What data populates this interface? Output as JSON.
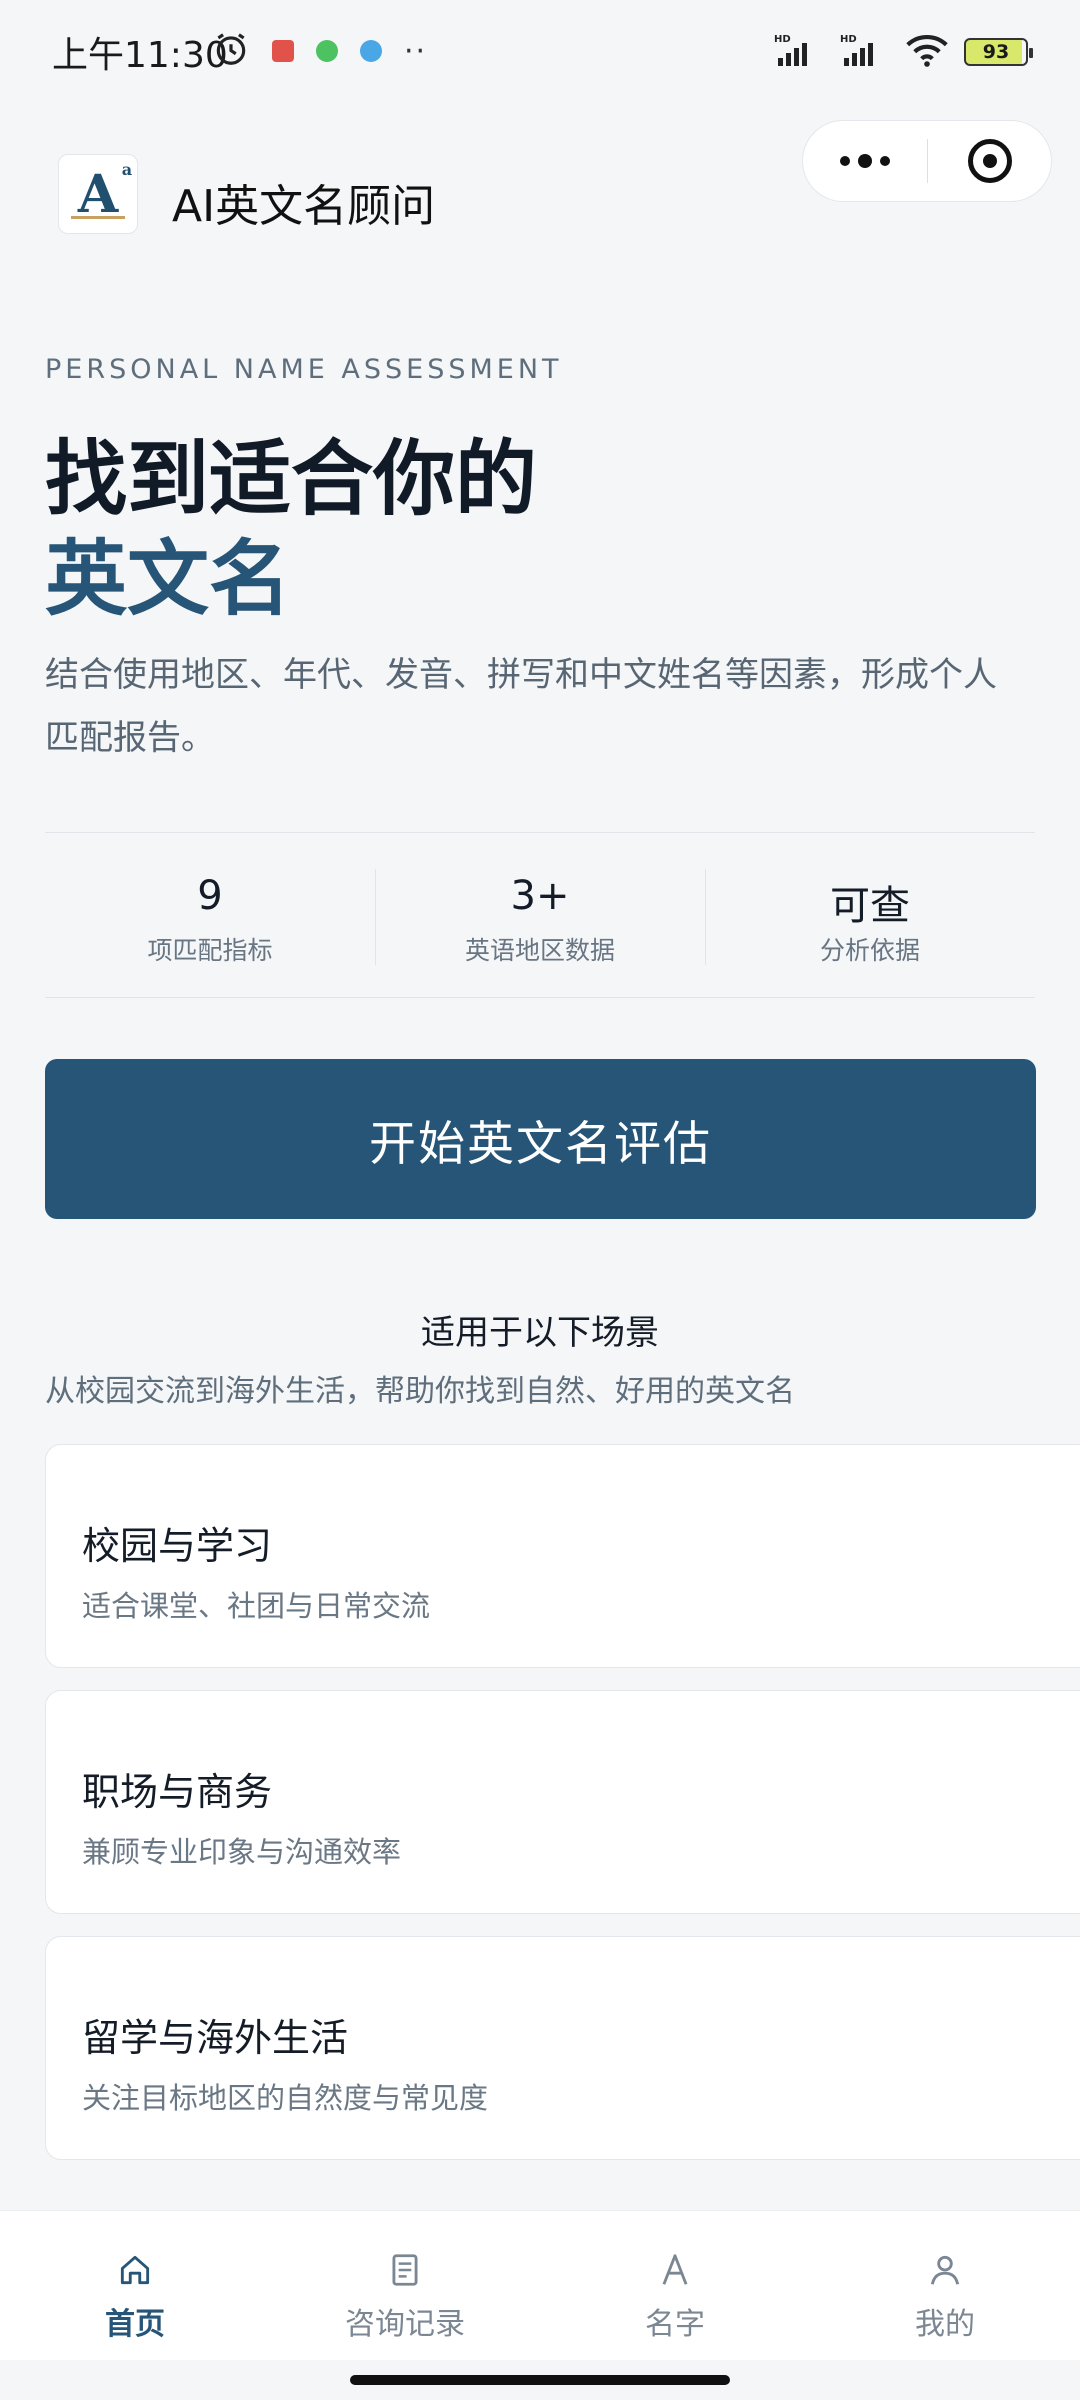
{
  "status_bar": {
    "time": "上午11:30",
    "battery": "93",
    "network_badge_1": "HD",
    "network_badge_2": "HD"
  },
  "header": {
    "logo_letter": "A",
    "logo_sup": "a",
    "title": "AI英文名顾问"
  },
  "hero": {
    "eyebrow": "PERSONAL NAME ASSESSMENT",
    "title_line1": "找到适合你的",
    "title_line2": "英文名",
    "description": "结合使用地区、年代、发音、拼写和中文姓名等因素，形成个人匹配报告。"
  },
  "stats": [
    {
      "value": "9",
      "label": "项匹配指标"
    },
    {
      "value": "3+",
      "label": "英语地区数据"
    },
    {
      "value": "可查",
      "label": "分析依据"
    }
  ],
  "cta": {
    "label": "开始英文名评估"
  },
  "scenarios": {
    "title": "适用于以下场景",
    "subtitle": "从校园交流到海外生活，帮助你找到自然、好用的英文名",
    "cards": [
      {
        "title": "校园与学习",
        "desc": "适合课堂、社团与日常交流"
      },
      {
        "title": "职场与商务",
        "desc": "兼顾专业印象与沟通效率"
      },
      {
        "title": "留学与海外生活",
        "desc": "关注目标地区的自然度与常见度"
      }
    ]
  },
  "tabs": [
    {
      "label": "首页",
      "icon": "home-icon",
      "active": true
    },
    {
      "label": "咨询记录",
      "icon": "document-icon",
      "active": false
    },
    {
      "label": "名字",
      "icon": "letter-a-icon",
      "active": false
    },
    {
      "label": "我的",
      "icon": "user-icon",
      "active": false
    }
  ],
  "colors": {
    "accent": "#265577",
    "background": "#f4f6f8",
    "text_primary": "#111a27",
    "text_secondary": "#586674"
  }
}
